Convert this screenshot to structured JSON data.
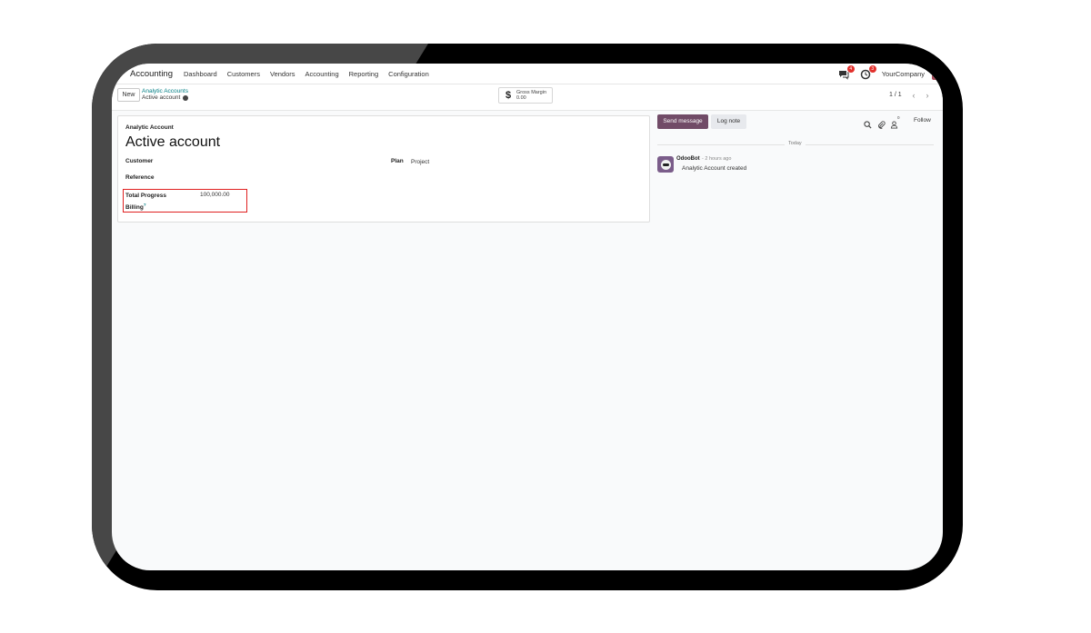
{
  "app": {
    "name": "Accounting"
  },
  "menu": [
    "Dashboard",
    "Customers",
    "Vendors",
    "Accounting",
    "Reporting",
    "Configuration"
  ],
  "systray": {
    "messages_badge": "4",
    "activities_badge": "3",
    "company": "YourCompany"
  },
  "control": {
    "new_label": "New",
    "breadcrumb_parent": "Analytic Accounts",
    "breadcrumb_current": "Active account",
    "smart_button": {
      "icon": "$",
      "label": "Gross Margin",
      "value": "0.00"
    },
    "pager": "1 / 1"
  },
  "form": {
    "header_label": "Analytic Account",
    "title": "Active account",
    "fields": {
      "customer": {
        "label": "Customer",
        "value": ""
      },
      "reference": {
        "label": "Reference",
        "value": ""
      },
      "plan": {
        "label": "Plan",
        "value": "Project"
      },
      "progress_billing": {
        "label_line1": "Total Progress",
        "label_line2": "Billing",
        "help": "?",
        "value": "100,000.00"
      }
    }
  },
  "chatter": {
    "send_message": "Send message",
    "log_note": "Log note",
    "followers_count": "0",
    "follow": "Follow",
    "date_separator": "Today",
    "messages": [
      {
        "author": "OdooBot",
        "time": "- 2 hours ago",
        "body": "Analytic Account created"
      }
    ]
  },
  "colors": {
    "brand": "#714b67",
    "link": "#017e84",
    "highlight": "#e02020"
  }
}
